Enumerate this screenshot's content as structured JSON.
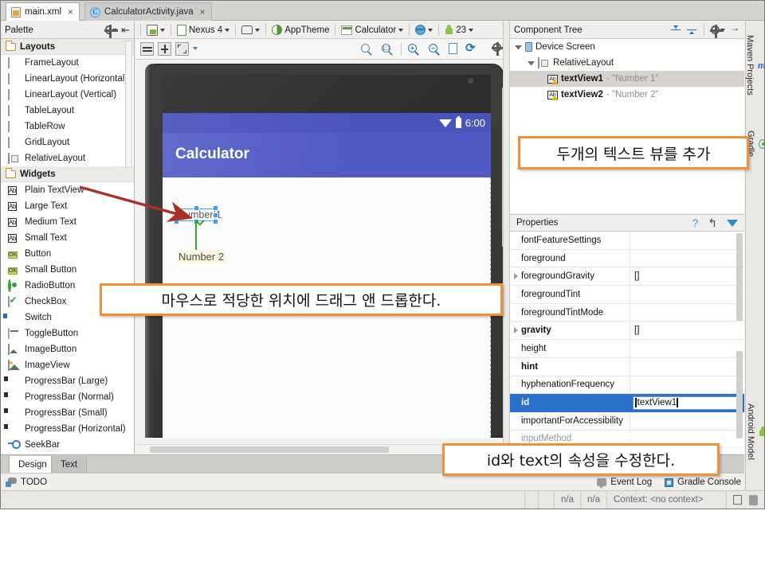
{
  "window": {
    "tabs": [
      {
        "label": "main.xml",
        "icon": "xml-file-icon",
        "active": true,
        "close": "×"
      },
      {
        "label": "CalculatorActivity.java",
        "icon": "java-file-icon",
        "active": false,
        "close": "×"
      }
    ]
  },
  "palette": {
    "title": "Palette",
    "groups": [
      {
        "label": "Layouts",
        "items": [
          {
            "label": "FrameLayout",
            "icon": "frame-layout-icon"
          },
          {
            "label": "LinearLayout (Horizontal)",
            "icon": "linear-layout-horizontal-icon"
          },
          {
            "label": "LinearLayout (Vertical)",
            "icon": "linear-layout-vertical-icon"
          },
          {
            "label": "TableLayout",
            "icon": "table-layout-icon"
          },
          {
            "label": "TableRow",
            "icon": "table-row-icon"
          },
          {
            "label": "GridLayout",
            "icon": "grid-layout-icon"
          },
          {
            "label": "RelativeLayout",
            "icon": "relative-layout-icon"
          }
        ]
      },
      {
        "label": "Widgets",
        "items": [
          {
            "label": "Plain TextView",
            "icon": "ab-textview-icon"
          },
          {
            "label": "Large Text",
            "icon": "ab-textview-icon"
          },
          {
            "label": "Medium Text",
            "icon": "ab-textview-icon"
          },
          {
            "label": "Small Text",
            "icon": "ab-textview-icon"
          },
          {
            "label": "Button",
            "icon": "ok-button-icon"
          },
          {
            "label": "Small Button",
            "icon": "ok-button-icon"
          },
          {
            "label": "RadioButton",
            "icon": "radio-button-icon"
          },
          {
            "label": "CheckBox",
            "icon": "checkbox-icon"
          },
          {
            "label": "Switch",
            "icon": "switch-icon"
          },
          {
            "label": "ToggleButton",
            "icon": "toggle-button-icon"
          },
          {
            "label": "ImageButton",
            "icon": "image-button-icon"
          },
          {
            "label": "ImageView",
            "icon": "image-view-icon"
          },
          {
            "label": "ProgressBar (Large)",
            "icon": "progress-bar-icon"
          },
          {
            "label": "ProgressBar (Normal)",
            "icon": "progress-bar-icon"
          },
          {
            "label": "ProgressBar (Small)",
            "icon": "progress-bar-icon"
          },
          {
            "label": "ProgressBar (Horizontal)",
            "icon": "progress-bar-icon"
          },
          {
            "label": "SeekBar",
            "icon": "seekbar-icon"
          }
        ]
      }
    ]
  },
  "design_toolbar": {
    "device": "Nexus 4",
    "theme": "AppTheme",
    "activity": "Calculator",
    "api_level": "23",
    "icons": [
      "device-config-icon",
      "device-icon",
      "orientation-icon",
      "theme-icon",
      "activity-icon",
      "locale-icon",
      "api-level-icon"
    ],
    "second_row_icons": [
      "align-icon",
      "distribute-icon",
      "expand-icon",
      "zoom-fit-icon",
      "zoom-actual-icon",
      "zoom-in-icon",
      "zoom-out-icon",
      "screenshot-icon",
      "refresh-icon",
      "settings-icon"
    ]
  },
  "preview": {
    "status_time": "6:00",
    "app_title": "Calculator",
    "textview1_text": "Number 1",
    "textview2_text": "Number 2"
  },
  "component_tree": {
    "title": "Component Tree",
    "rows": [
      {
        "label": "Device Screen",
        "value": "",
        "depth": 0,
        "icon": "device-screen-icon",
        "selected": false
      },
      {
        "label": "RelativeLayout",
        "value": "",
        "depth": 1,
        "icon": "relative-layout-icon",
        "selected": false
      },
      {
        "label": "textView1",
        "value": "- \"Number 1\"",
        "depth": 2,
        "icon": "ab-textview-icon",
        "selected": true
      },
      {
        "label": "textView2",
        "value": "- \"Number 2\"",
        "depth": 2,
        "icon": "ab-textview-icon",
        "selected": false
      }
    ]
  },
  "properties": {
    "title": "Properties",
    "rows": [
      {
        "name": "fontFeatureSettings",
        "value": "",
        "bold": false,
        "expandable": false,
        "selected": false
      },
      {
        "name": "foreground",
        "value": "",
        "bold": false,
        "expandable": false,
        "selected": false
      },
      {
        "name": "foregroundGravity",
        "value": "[]",
        "bold": false,
        "expandable": true,
        "selected": false
      },
      {
        "name": "foregroundTint",
        "value": "",
        "bold": false,
        "expandable": false,
        "selected": false
      },
      {
        "name": "foregroundTintMode",
        "value": "",
        "bold": false,
        "expandable": false,
        "selected": false
      },
      {
        "name": "gravity",
        "value": "[]",
        "bold": true,
        "expandable": true,
        "selected": false
      },
      {
        "name": "height",
        "value": "",
        "bold": false,
        "expandable": false,
        "selected": false
      },
      {
        "name": "hint",
        "value": "",
        "bold": true,
        "expandable": false,
        "selected": false
      },
      {
        "name": "hyphenationFrequency",
        "value": "",
        "bold": false,
        "expandable": false,
        "selected": false
      },
      {
        "name": "id",
        "value": "textView1",
        "bold": true,
        "expandable": false,
        "selected": true
      },
      {
        "name": "importantForAccessibility",
        "value": "",
        "bold": false,
        "expandable": false,
        "selected": false
      },
      {
        "name": "inputMethod",
        "value": "",
        "bold": false,
        "expandable": false,
        "selected": false
      }
    ],
    "editing_value": "textView1"
  },
  "right_strip": {
    "top_tabs": [
      {
        "label": "Maven Projects",
        "icon": "maven-icon"
      },
      {
        "label": "Gradle",
        "icon": "gradle-icon"
      }
    ],
    "bottom_tabs": [
      {
        "label": "Android Model",
        "icon": "android-icon"
      }
    ]
  },
  "bottom": {
    "editor_tabs": [
      {
        "label": "Design",
        "active": true
      },
      {
        "label": "Text",
        "active": false
      }
    ],
    "todo_label": "TODO",
    "event_log": "Event Log",
    "gradle_console": "Gradle Console",
    "status_cells": [
      "n/a",
      "n/a",
      "Context: <no context>"
    ]
  },
  "annotations": [
    {
      "id": "anno-two-textviews",
      "text": "두개의 텍스트 뷰를 추가"
    },
    {
      "id": "anno-drag-drop",
      "text": "마우스로 적당한 위치에 드래그 앤 드롭한다."
    },
    {
      "id": "anno-edit-props",
      "text": "id와 text의 속성을 수정한다."
    }
  ],
  "colors": {
    "accent_orange": "#f19037",
    "selection_blue": "#2a6fc9",
    "handle_blue": "#3aa0e8",
    "appbar_blue": "#4f5ac4",
    "statusbar_blue": "#4a55bb",
    "arrow_red": "#a83228",
    "arrow_green": "#2fab2f"
  }
}
